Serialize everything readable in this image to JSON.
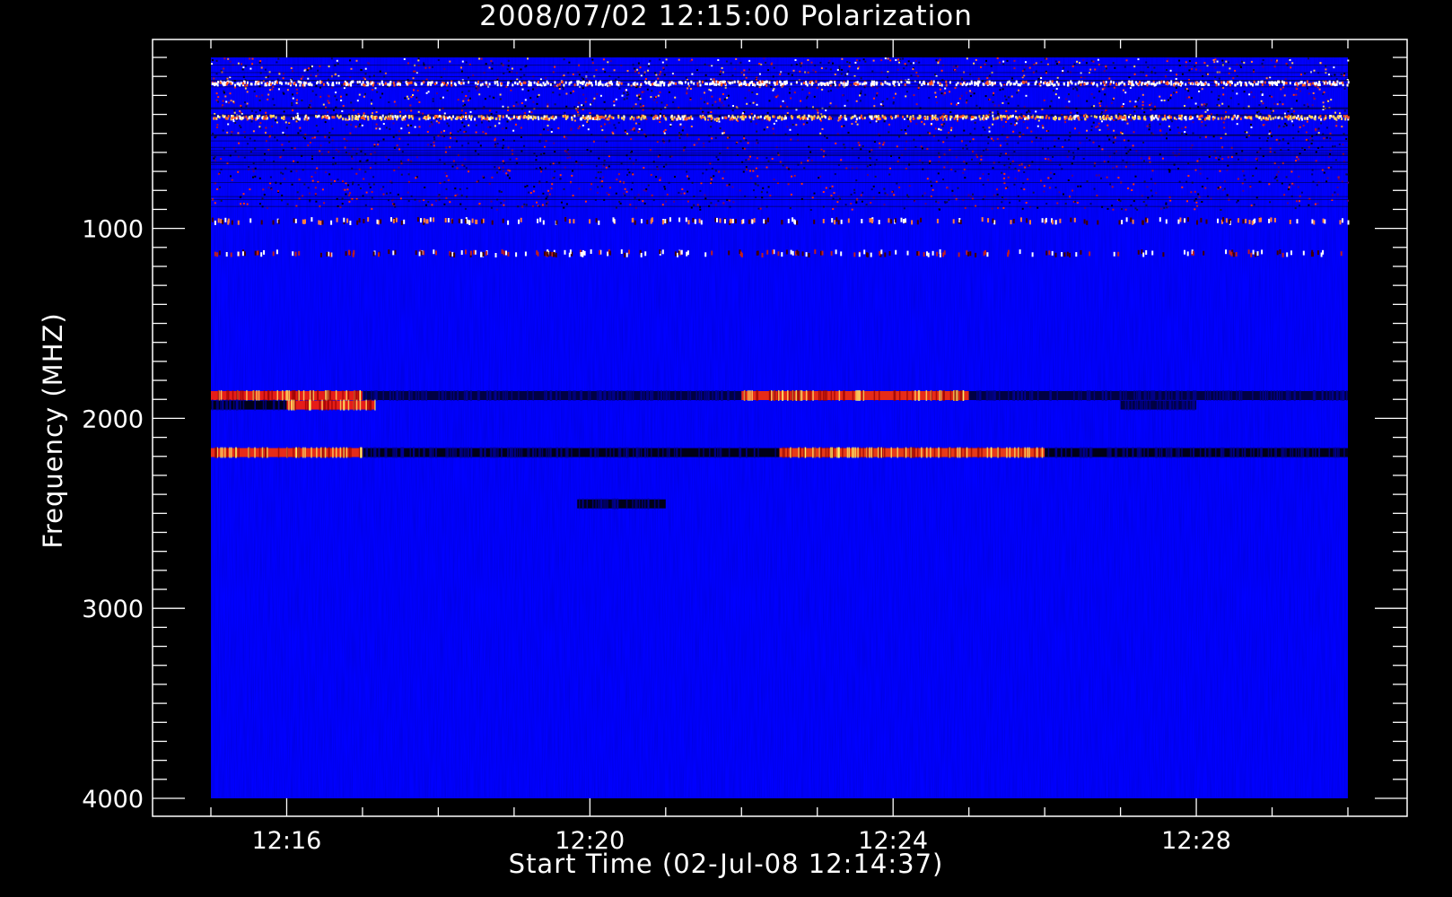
{
  "chart_data": {
    "type": "heatmap",
    "title": "2008/07/02 12:15:00 Polarization",
    "xlabel": "Start Time (02-Jul-08 12:14:37)",
    "ylabel": "Frequency (MHZ)",
    "x_range_minutes": [
      "12:15:00",
      "12:30:00"
    ],
    "y_range": [
      100,
      4000
    ],
    "y_inverted": true,
    "x_ticks": [
      {
        "minute": 16,
        "label": "12:16"
      },
      {
        "minute": 20,
        "label": "12:20"
      },
      {
        "minute": 24,
        "label": "12:24"
      },
      {
        "minute": 28,
        "label": "12:28"
      }
    ],
    "y_ticks": [
      {
        "value": 1000,
        "label": "1000"
      },
      {
        "value": 2000,
        "label": "2000"
      },
      {
        "value": 3000,
        "label": "3000"
      },
      {
        "value": 4000,
        "label": "4000"
      }
    ],
    "colormap": {
      "background": "#0000ff",
      "low": "#000000",
      "high": "#ff2000",
      "peak": "#ffff80"
    },
    "features": [
      {
        "kind": "noisy_band",
        "freq_from": 100,
        "freq_to": 900,
        "color": "mixed"
      },
      {
        "kind": "dashed_line",
        "freq": 950,
        "color": "#ff8040"
      },
      {
        "kind": "dashed_line",
        "freq": 1120,
        "color": "#c02020"
      },
      {
        "kind": "bright_line",
        "freq": 230,
        "color": "#ffffff"
      },
      {
        "kind": "bright_line",
        "freq": 410,
        "color": "#ffd060"
      },
      {
        "kind": "band",
        "freq": 1880,
        "segments": [
          {
            "from": "12:15:00",
            "to": "12:17:00",
            "color": "#ff2000"
          },
          {
            "from": "12:17:00",
            "to": "12:22:00",
            "color": "#000030"
          },
          {
            "from": "12:22:00",
            "to": "12:25:00",
            "color": "#ff3000"
          },
          {
            "from": "12:25:00",
            "to": "12:30:00",
            "color": "#000030"
          }
        ]
      },
      {
        "kind": "band",
        "freq": 1930,
        "segments": [
          {
            "from": "12:15:00",
            "to": "12:16:00",
            "color": "#000000"
          },
          {
            "from": "12:16:00",
            "to": "12:17:10",
            "color": "#ff2000"
          },
          {
            "from": "12:27:00",
            "to": "12:28:00",
            "color": "#000030"
          }
        ]
      },
      {
        "kind": "band",
        "freq": 2180,
        "segments": [
          {
            "from": "12:15:00",
            "to": "12:17:00",
            "color": "#ff3000"
          },
          {
            "from": "12:17:00",
            "to": "12:22:30",
            "color": "#000000"
          },
          {
            "from": "12:22:30",
            "to": "12:26:00",
            "color": "#ff4000"
          },
          {
            "from": "12:26:00",
            "to": "12:30:00",
            "color": "#000000"
          }
        ]
      },
      {
        "kind": "band",
        "freq": 2450,
        "segments": [
          {
            "from": "12:19:50",
            "to": "12:21:00",
            "color": "#000000"
          }
        ]
      }
    ]
  }
}
